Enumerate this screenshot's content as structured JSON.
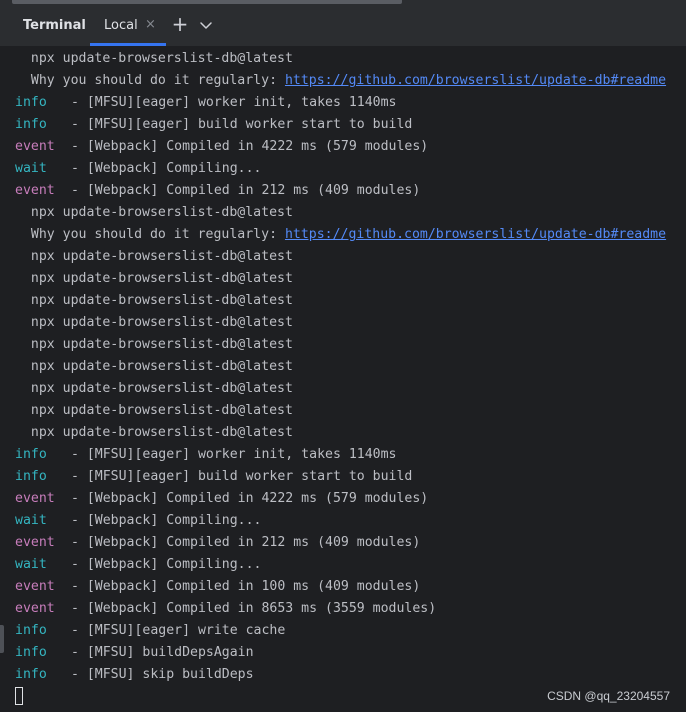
{
  "tool_window": {
    "title": "Terminal",
    "tabs": [
      {
        "label": "Local",
        "active": true,
        "close_glyph": "×"
      }
    ],
    "add_glyph": "+",
    "menu_icon": "chevron-down-icon"
  },
  "terminal": {
    "lines": [
      {
        "level": "",
        "text": "  npx update-browserslist-db@latest"
      },
      {
        "level": "",
        "text": "  Why you should do it regularly: ",
        "link": "https://github.com/browserslist/update-db#readme"
      },
      {
        "level": "info",
        "text": " - [MFSU][eager] worker init, takes 1140ms"
      },
      {
        "level": "info",
        "text": " - [MFSU][eager] build worker start to build"
      },
      {
        "level": "event",
        "text": " - [Webpack] Compiled in 4222 ms (579 modules)"
      },
      {
        "level": "wait",
        "text": " - [Webpack] Compiling..."
      },
      {
        "level": "event",
        "text": " - [Webpack] Compiled in 212 ms (409 modules)"
      },
      {
        "level": "",
        "text": "  npx update-browserslist-db@latest"
      },
      {
        "level": "",
        "text": "  Why you should do it regularly: ",
        "link": "https://github.com/browserslist/update-db#readme"
      },
      {
        "level": "",
        "text": "  npx update-browserslist-db@latest"
      },
      {
        "level": "",
        "text": "  npx update-browserslist-db@latest"
      },
      {
        "level": "",
        "text": "  npx update-browserslist-db@latest"
      },
      {
        "level": "",
        "text": "  npx update-browserslist-db@latest"
      },
      {
        "level": "",
        "text": "  npx update-browserslist-db@latest"
      },
      {
        "level": "",
        "text": "  npx update-browserslist-db@latest"
      },
      {
        "level": "",
        "text": "  npx update-browserslist-db@latest"
      },
      {
        "level": "",
        "text": "  npx update-browserslist-db@latest"
      },
      {
        "level": "",
        "text": "  npx update-browserslist-db@latest"
      },
      {
        "level": "info",
        "text": " - [MFSU][eager] worker init, takes 1140ms"
      },
      {
        "level": "info",
        "text": " - [MFSU][eager] build worker start to build"
      },
      {
        "level": "event",
        "text": " - [Webpack] Compiled in 4222 ms (579 modules)"
      },
      {
        "level": "wait",
        "text": " - [Webpack] Compiling..."
      },
      {
        "level": "event",
        "text": " - [Webpack] Compiled in 212 ms (409 modules)"
      },
      {
        "level": "wait",
        "text": " - [Webpack] Compiling..."
      },
      {
        "level": "event",
        "text": " - [Webpack] Compiled in 100 ms (409 modules)"
      },
      {
        "level": "event",
        "text": " - [Webpack] Compiled in 8653 ms (3559 modules)"
      },
      {
        "level": "info",
        "text": " - [MFSU][eager] write cache"
      },
      {
        "level": "info",
        "text": " - [MFSU] buildDepsAgain"
      },
      {
        "level": "info",
        "text": " - [MFSU] skip buildDeps"
      }
    ]
  },
  "watermark": "CSDN @qq_23204557",
  "colors": {
    "background": "#1e1f22",
    "tab_bar": "#2b2d30",
    "text": "#bcbec4",
    "level_info": "#34b5c1",
    "level_event": "#c77dbb",
    "link": "#548af7",
    "active_tab_accent": "#3574f0"
  }
}
